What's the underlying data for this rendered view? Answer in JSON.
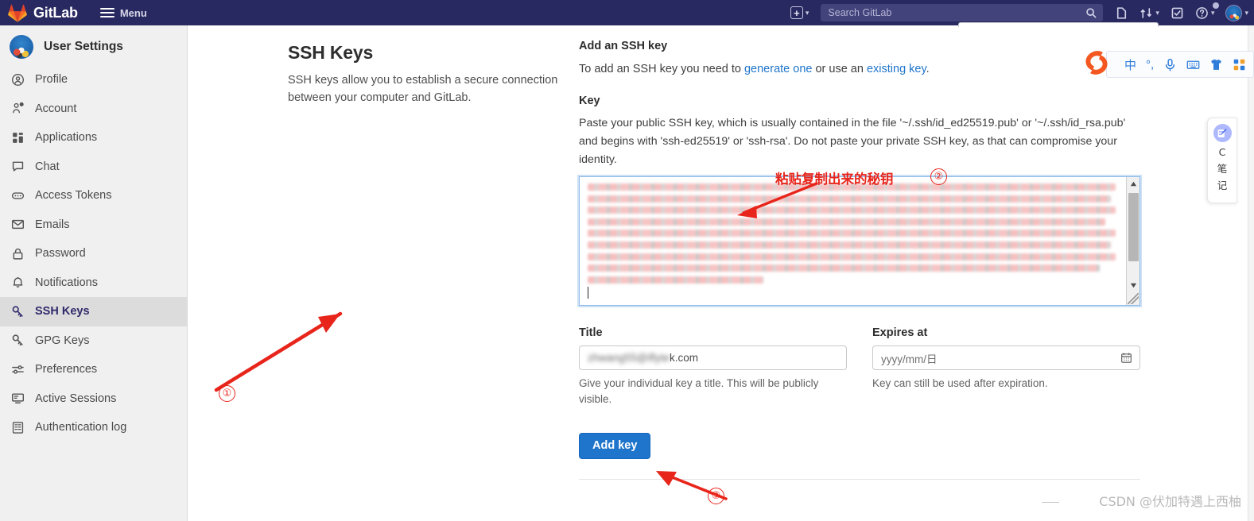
{
  "navbar": {
    "brand": "GitLab",
    "menu_label": "Menu",
    "search_placeholder": "Search GitLab",
    "search_value": "",
    "icons": {
      "plus": "plus-square-icon",
      "issues": "issues-icon",
      "merge_requests": "merge-request-icon",
      "todos": "todo-check-icon",
      "help": "help-question-icon",
      "avatar": "user-avatar"
    }
  },
  "sidebar": {
    "title": "User Settings",
    "items": [
      {
        "label": "Profile",
        "icon": "profile-icon",
        "active": false
      },
      {
        "label": "Account",
        "icon": "account-gear-icon",
        "active": false
      },
      {
        "label": "Applications",
        "icon": "applications-grid-icon",
        "active": false
      },
      {
        "label": "Chat",
        "icon": "chat-bubble-icon",
        "active": false
      },
      {
        "label": "Access Tokens",
        "icon": "access-token-icon",
        "active": false
      },
      {
        "label": "Emails",
        "icon": "envelope-icon",
        "active": false
      },
      {
        "label": "Password",
        "icon": "lock-icon",
        "active": false
      },
      {
        "label": "Notifications",
        "icon": "bell-icon",
        "active": false
      },
      {
        "label": "SSH Keys",
        "icon": "key-icon",
        "active": true
      },
      {
        "label": "GPG Keys",
        "icon": "key-icon",
        "active": false
      },
      {
        "label": "Preferences",
        "icon": "sliders-icon",
        "active": false
      },
      {
        "label": "Active Sessions",
        "icon": "monitor-icon",
        "active": false
      },
      {
        "label": "Authentication log",
        "icon": "log-list-icon",
        "active": false
      }
    ]
  },
  "page": {
    "title": "SSH Keys",
    "description": "SSH keys allow you to establish a secure connection between your computer and GitLab."
  },
  "form": {
    "section_title": "Add an SSH key",
    "intro_prefix": "To add an SSH key you need to ",
    "intro_link1": "generate one",
    "intro_middle": " or use an ",
    "intro_link2": "existing key",
    "intro_suffix": ".",
    "key_label": "Key",
    "key_help": "Paste your public SSH key, which is usually contained in the file '~/.ssh/id_ed25519.pub' or '~/.ssh/id_rsa.pub' and begins with 'ssh-ed25519' or 'ssh-rsa'. Do not paste your private SSH key, as that can compromise your identity.",
    "key_textarea_value": "",
    "title_label": "Title",
    "title_value_blurred": "zhwang55@iflyte",
    "title_value_tail": "k.com",
    "title_help": "Give your individual key a title. This will be publicly visible.",
    "expires_label": "Expires at",
    "expires_placeholder": "yyyy/mm/日",
    "expires_help": "Key can still be used after expiration.",
    "submit_label": "Add key"
  },
  "annotations": {
    "marker_1": "①",
    "marker_2": "②",
    "marker_3": "③",
    "note_chinese": "粘贴复制出来的秘钥",
    "arrow_color": "#e8251b"
  },
  "ime": {
    "logo": "sogou-s-logo",
    "items": [
      {
        "label": "中",
        "name": "chinese-mode-toggle"
      },
      {
        "label": "°,",
        "name": "punctuation-toggle"
      },
      {
        "label": "",
        "name": "microphone-icon"
      },
      {
        "label": "",
        "name": "soft-keyboard-icon"
      },
      {
        "label": "",
        "name": "skin-shirt-icon"
      },
      {
        "label": "",
        "name": "apps-grid-icon"
      }
    ]
  },
  "note_widget": {
    "icon": "note-pen-icon",
    "lines": [
      "C",
      "笔",
      "记"
    ]
  },
  "watermark": {
    "text": "CSDN @伏加特遇上西柚"
  }
}
